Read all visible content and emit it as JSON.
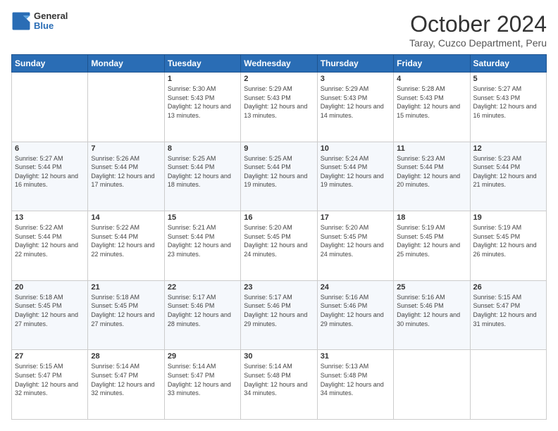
{
  "header": {
    "logo_general": "General",
    "logo_blue": "Blue",
    "title": "October 2024",
    "subtitle": "Taray, Cuzco Department, Peru"
  },
  "days_of_week": [
    "Sunday",
    "Monday",
    "Tuesday",
    "Wednesday",
    "Thursday",
    "Friday",
    "Saturday"
  ],
  "weeks": [
    [
      {
        "num": "",
        "sunrise": "",
        "sunset": "",
        "daylight": ""
      },
      {
        "num": "",
        "sunrise": "",
        "sunset": "",
        "daylight": ""
      },
      {
        "num": "1",
        "sunrise": "Sunrise: 5:30 AM",
        "sunset": "Sunset: 5:43 PM",
        "daylight": "Daylight: 12 hours and 13 minutes."
      },
      {
        "num": "2",
        "sunrise": "Sunrise: 5:29 AM",
        "sunset": "Sunset: 5:43 PM",
        "daylight": "Daylight: 12 hours and 13 minutes."
      },
      {
        "num": "3",
        "sunrise": "Sunrise: 5:29 AM",
        "sunset": "Sunset: 5:43 PM",
        "daylight": "Daylight: 12 hours and 14 minutes."
      },
      {
        "num": "4",
        "sunrise": "Sunrise: 5:28 AM",
        "sunset": "Sunset: 5:43 PM",
        "daylight": "Daylight: 12 hours and 15 minutes."
      },
      {
        "num": "5",
        "sunrise": "Sunrise: 5:27 AM",
        "sunset": "Sunset: 5:43 PM",
        "daylight": "Daylight: 12 hours and 16 minutes."
      }
    ],
    [
      {
        "num": "6",
        "sunrise": "Sunrise: 5:27 AM",
        "sunset": "Sunset: 5:44 PM",
        "daylight": "Daylight: 12 hours and 16 minutes."
      },
      {
        "num": "7",
        "sunrise": "Sunrise: 5:26 AM",
        "sunset": "Sunset: 5:44 PM",
        "daylight": "Daylight: 12 hours and 17 minutes."
      },
      {
        "num": "8",
        "sunrise": "Sunrise: 5:25 AM",
        "sunset": "Sunset: 5:44 PM",
        "daylight": "Daylight: 12 hours and 18 minutes."
      },
      {
        "num": "9",
        "sunrise": "Sunrise: 5:25 AM",
        "sunset": "Sunset: 5:44 PM",
        "daylight": "Daylight: 12 hours and 19 minutes."
      },
      {
        "num": "10",
        "sunrise": "Sunrise: 5:24 AM",
        "sunset": "Sunset: 5:44 PM",
        "daylight": "Daylight: 12 hours and 19 minutes."
      },
      {
        "num": "11",
        "sunrise": "Sunrise: 5:23 AM",
        "sunset": "Sunset: 5:44 PM",
        "daylight": "Daylight: 12 hours and 20 minutes."
      },
      {
        "num": "12",
        "sunrise": "Sunrise: 5:23 AM",
        "sunset": "Sunset: 5:44 PM",
        "daylight": "Daylight: 12 hours and 21 minutes."
      }
    ],
    [
      {
        "num": "13",
        "sunrise": "Sunrise: 5:22 AM",
        "sunset": "Sunset: 5:44 PM",
        "daylight": "Daylight: 12 hours and 22 minutes."
      },
      {
        "num": "14",
        "sunrise": "Sunrise: 5:22 AM",
        "sunset": "Sunset: 5:44 PM",
        "daylight": "Daylight: 12 hours and 22 minutes."
      },
      {
        "num": "15",
        "sunrise": "Sunrise: 5:21 AM",
        "sunset": "Sunset: 5:44 PM",
        "daylight": "Daylight: 12 hours and 23 minutes."
      },
      {
        "num": "16",
        "sunrise": "Sunrise: 5:20 AM",
        "sunset": "Sunset: 5:45 PM",
        "daylight": "Daylight: 12 hours and 24 minutes."
      },
      {
        "num": "17",
        "sunrise": "Sunrise: 5:20 AM",
        "sunset": "Sunset: 5:45 PM",
        "daylight": "Daylight: 12 hours and 24 minutes."
      },
      {
        "num": "18",
        "sunrise": "Sunrise: 5:19 AM",
        "sunset": "Sunset: 5:45 PM",
        "daylight": "Daylight: 12 hours and 25 minutes."
      },
      {
        "num": "19",
        "sunrise": "Sunrise: 5:19 AM",
        "sunset": "Sunset: 5:45 PM",
        "daylight": "Daylight: 12 hours and 26 minutes."
      }
    ],
    [
      {
        "num": "20",
        "sunrise": "Sunrise: 5:18 AM",
        "sunset": "Sunset: 5:45 PM",
        "daylight": "Daylight: 12 hours and 27 minutes."
      },
      {
        "num": "21",
        "sunrise": "Sunrise: 5:18 AM",
        "sunset": "Sunset: 5:45 PM",
        "daylight": "Daylight: 12 hours and 27 minutes."
      },
      {
        "num": "22",
        "sunrise": "Sunrise: 5:17 AM",
        "sunset": "Sunset: 5:46 PM",
        "daylight": "Daylight: 12 hours and 28 minutes."
      },
      {
        "num": "23",
        "sunrise": "Sunrise: 5:17 AM",
        "sunset": "Sunset: 5:46 PM",
        "daylight": "Daylight: 12 hours and 29 minutes."
      },
      {
        "num": "24",
        "sunrise": "Sunrise: 5:16 AM",
        "sunset": "Sunset: 5:46 PM",
        "daylight": "Daylight: 12 hours and 29 minutes."
      },
      {
        "num": "25",
        "sunrise": "Sunrise: 5:16 AM",
        "sunset": "Sunset: 5:46 PM",
        "daylight": "Daylight: 12 hours and 30 minutes."
      },
      {
        "num": "26",
        "sunrise": "Sunrise: 5:15 AM",
        "sunset": "Sunset: 5:47 PM",
        "daylight": "Daylight: 12 hours and 31 minutes."
      }
    ],
    [
      {
        "num": "27",
        "sunrise": "Sunrise: 5:15 AM",
        "sunset": "Sunset: 5:47 PM",
        "daylight": "Daylight: 12 hours and 32 minutes."
      },
      {
        "num": "28",
        "sunrise": "Sunrise: 5:14 AM",
        "sunset": "Sunset: 5:47 PM",
        "daylight": "Daylight: 12 hours and 32 minutes."
      },
      {
        "num": "29",
        "sunrise": "Sunrise: 5:14 AM",
        "sunset": "Sunset: 5:47 PM",
        "daylight": "Daylight: 12 hours and 33 minutes."
      },
      {
        "num": "30",
        "sunrise": "Sunrise: 5:14 AM",
        "sunset": "Sunset: 5:48 PM",
        "daylight": "Daylight: 12 hours and 34 minutes."
      },
      {
        "num": "31",
        "sunrise": "Sunrise: 5:13 AM",
        "sunset": "Sunset: 5:48 PM",
        "daylight": "Daylight: 12 hours and 34 minutes."
      },
      {
        "num": "",
        "sunrise": "",
        "sunset": "",
        "daylight": ""
      },
      {
        "num": "",
        "sunrise": "",
        "sunset": "",
        "daylight": ""
      }
    ]
  ]
}
